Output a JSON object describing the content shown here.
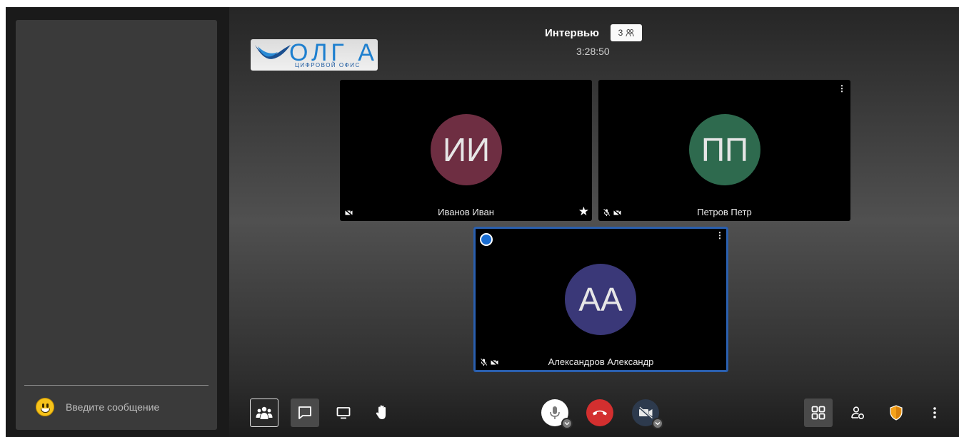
{
  "chat": {
    "placeholder": "Введите сообщение",
    "emoji_icon": "smiley-icon"
  },
  "logo": {
    "word": "ОЛГ А",
    "subtitle": "ЦИФРОВОЙ ОФИС"
  },
  "conference": {
    "title": "Интервью",
    "participant_count": "3",
    "timer": "3:28:50"
  },
  "participants": [
    {
      "name": "Иванов Иван",
      "initials": "ИИ",
      "avatar_color": "#6e2e42",
      "icons": [
        "video-off-icon"
      ],
      "moderator": true
    },
    {
      "name": "Петров Петр",
      "initials": "ПП",
      "avatar_color": "#2e6a4e",
      "icons": [
        "mic-off-icon",
        "video-off-icon"
      ]
    },
    {
      "name": "Александров Александр",
      "initials": "АА",
      "avatar_color": "#3a3878",
      "icons": [
        "mic-off-icon",
        "video-off-icon"
      ],
      "active_speaker": true
    }
  ],
  "toolbar": {
    "left": [
      "participants-icon",
      "chat-icon",
      "screen-share-icon",
      "raise-hand-icon"
    ],
    "center": [
      "microphone-icon",
      "hangup-icon",
      "camera-off-icon"
    ],
    "right": [
      "tile-view-icon",
      "invite-icon",
      "security-shield-icon",
      "more-icon"
    ]
  },
  "colors": {
    "hangup": "#d32f2f",
    "active_border": "#2a5fae",
    "shield": "#f5a21a"
  }
}
